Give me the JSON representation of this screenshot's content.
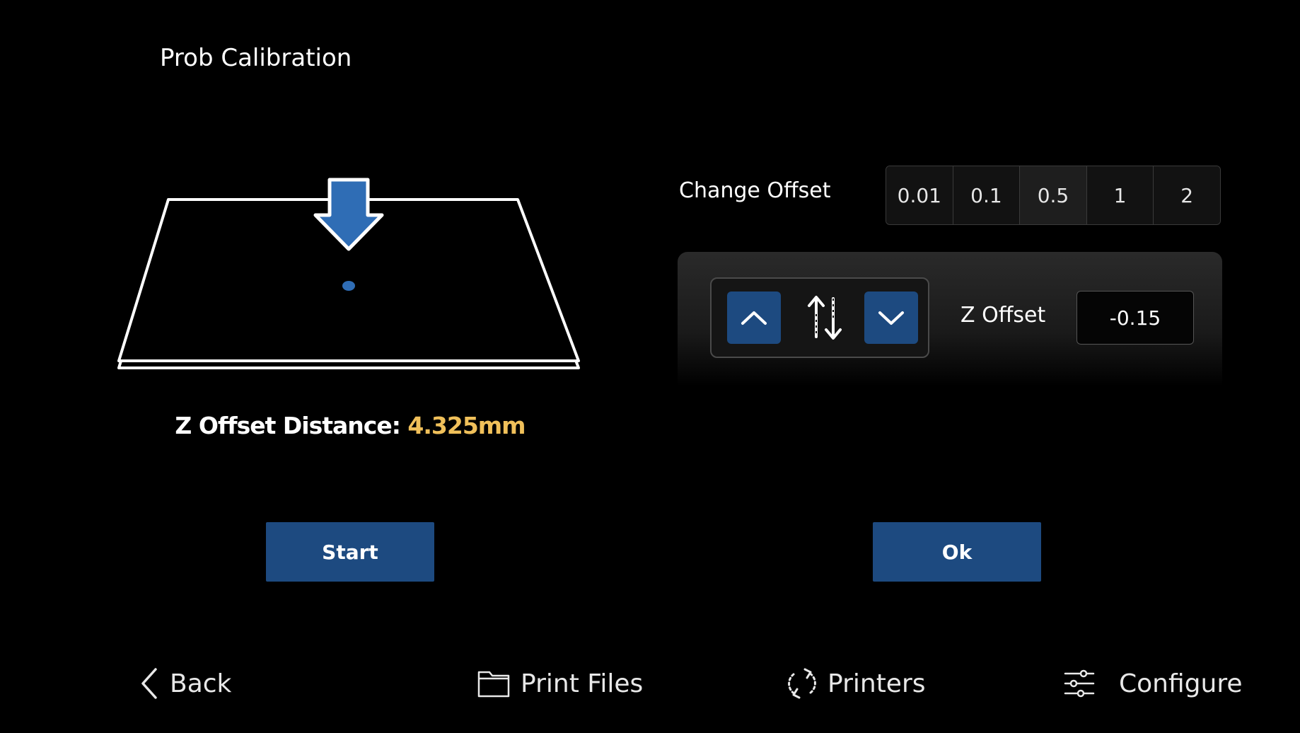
{
  "title": "Prob Calibration",
  "distance": {
    "label": "Z Offset Distance: ",
    "value": "4.325mm"
  },
  "buttons": {
    "start_label": "Start",
    "ok_label": "Ok"
  },
  "change_offset": {
    "label": "Change Offset",
    "steps": [
      "0.01",
      "0.1",
      "0.5",
      "1",
      "2"
    ],
    "selected": "0.5"
  },
  "z_offset": {
    "label": "Z Offset",
    "value": "-0.15"
  },
  "nav": {
    "back": "Back",
    "print_files": "Print Files",
    "printers": "Printers",
    "configure": "Configure"
  },
  "colors": {
    "accent_blue": "#1d4a80",
    "icon_blue": "#2f6db5",
    "distance_highlight": "#f0c05a",
    "background": "#000000"
  },
  "icons": {
    "probe_arrow": "down-arrow-icon",
    "up": "chevron-up-icon",
    "down": "chevron-down-icon",
    "updown": "up-down-arrows-icon",
    "back": "chevron-left-icon",
    "print_files": "folder-icon",
    "printers": "refresh-icon",
    "configure": "sliders-icon"
  }
}
